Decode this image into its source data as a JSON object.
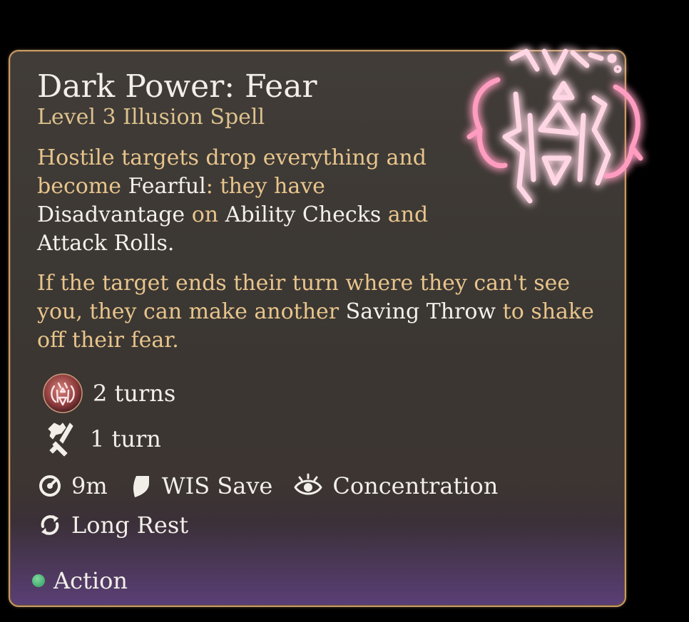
{
  "spell": {
    "name": "Dark Power: Fear",
    "subtitle": "Level 3 Illusion Spell",
    "description_1": [
      {
        "text": "Hostile targets drop everything and become ",
        "highlight": false
      },
      {
        "text": "Fearful",
        "highlight": true
      },
      {
        "text": ": they have ",
        "highlight": false
      },
      {
        "text": "Disadvantage",
        "highlight": true
      },
      {
        "text": " on ",
        "highlight": false
      },
      {
        "text": "Ability Checks",
        "highlight": true
      },
      {
        "text": " and ",
        "highlight": false
      },
      {
        "text": "Attack Rolls",
        "highlight": true
      },
      {
        "text": ".",
        "highlight": true
      }
    ],
    "description_2": [
      {
        "text": "If the target ends their turn where they can't see you, they can make another ",
        "highlight": false
      },
      {
        "text": "Saving Throw",
        "highlight": true
      },
      {
        "text": " to shake off their fear.",
        "highlight": false
      }
    ]
  },
  "effects": {
    "fear_duration": "2 turns",
    "drop_duration": "1 turn"
  },
  "properties": {
    "range": "9m",
    "save": "WIS Save",
    "concentration": "Concentration",
    "recharge": "Long Rest"
  },
  "cost": {
    "label": "Action",
    "dot_color": "#3fae6a"
  },
  "icons": {
    "emblem": "fear-emblem-icon",
    "status": "fear-status-icon",
    "drop": "drop-weapon-icon",
    "range": "range-icon",
    "save": "shield-icon",
    "concentration": "concentration-eye-icon",
    "recharge": "long-rest-icon"
  }
}
